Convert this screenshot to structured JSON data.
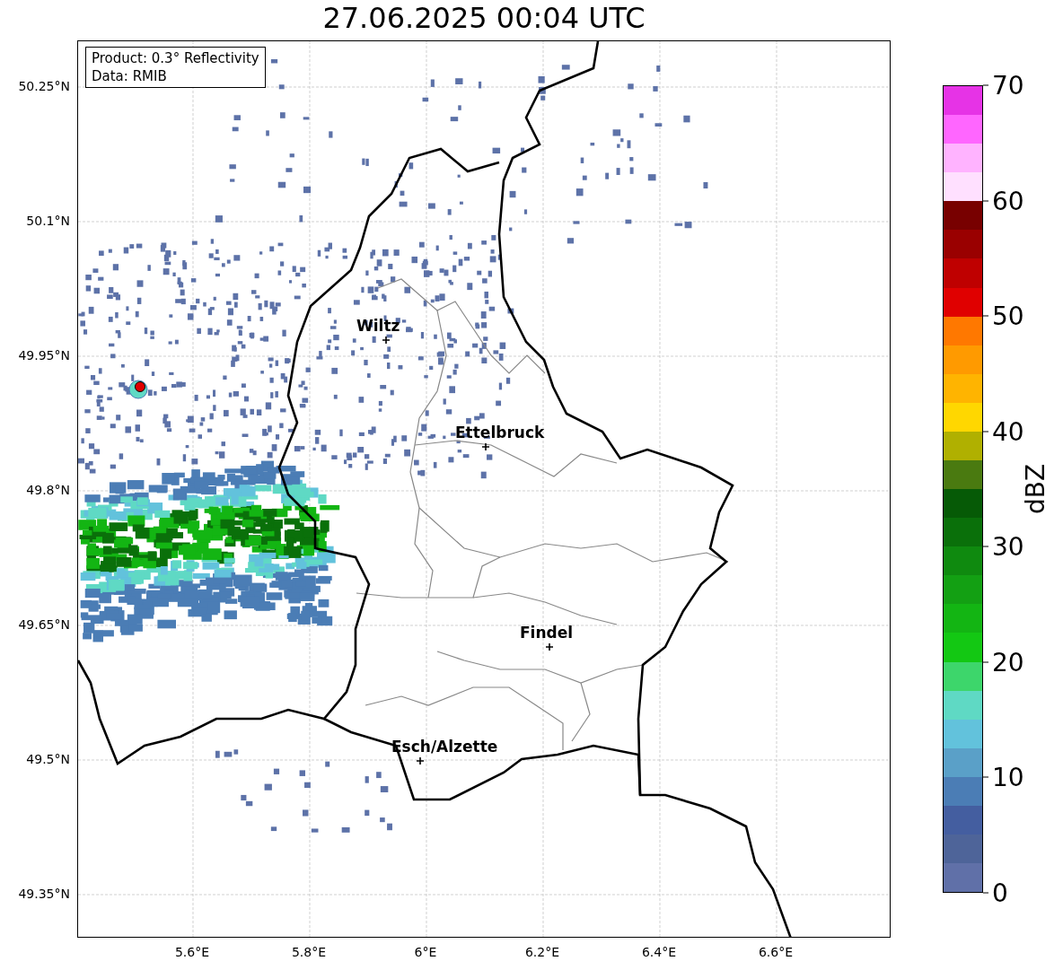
{
  "title": "27.06.2025 00:04 UTC",
  "info_box": {
    "lines": [
      "Product: 0.3° Reflectivity",
      "Data: RMIB"
    ]
  },
  "map": {
    "lat_ticks": [
      "50.25°N",
      "50.1°N",
      "49.95°N",
      "49.8°N",
      "49.65°N",
      "49.5°N",
      "49.35°N"
    ],
    "lon_ticks": [
      "5.6°E",
      "5.8°E",
      "6°E",
      "6.2°E",
      "6.4°E",
      "6.6°E"
    ],
    "cities": [
      {
        "name": "Wiltz"
      },
      {
        "name": "Ettelbruck"
      },
      {
        "name": "Findel"
      },
      {
        "name": "Esch/Alzette"
      }
    ]
  },
  "colorbar": {
    "label": "dBZ",
    "ticks": [
      "70",
      "60",
      "50",
      "40",
      "30",
      "20",
      "10",
      "0"
    ]
  }
}
